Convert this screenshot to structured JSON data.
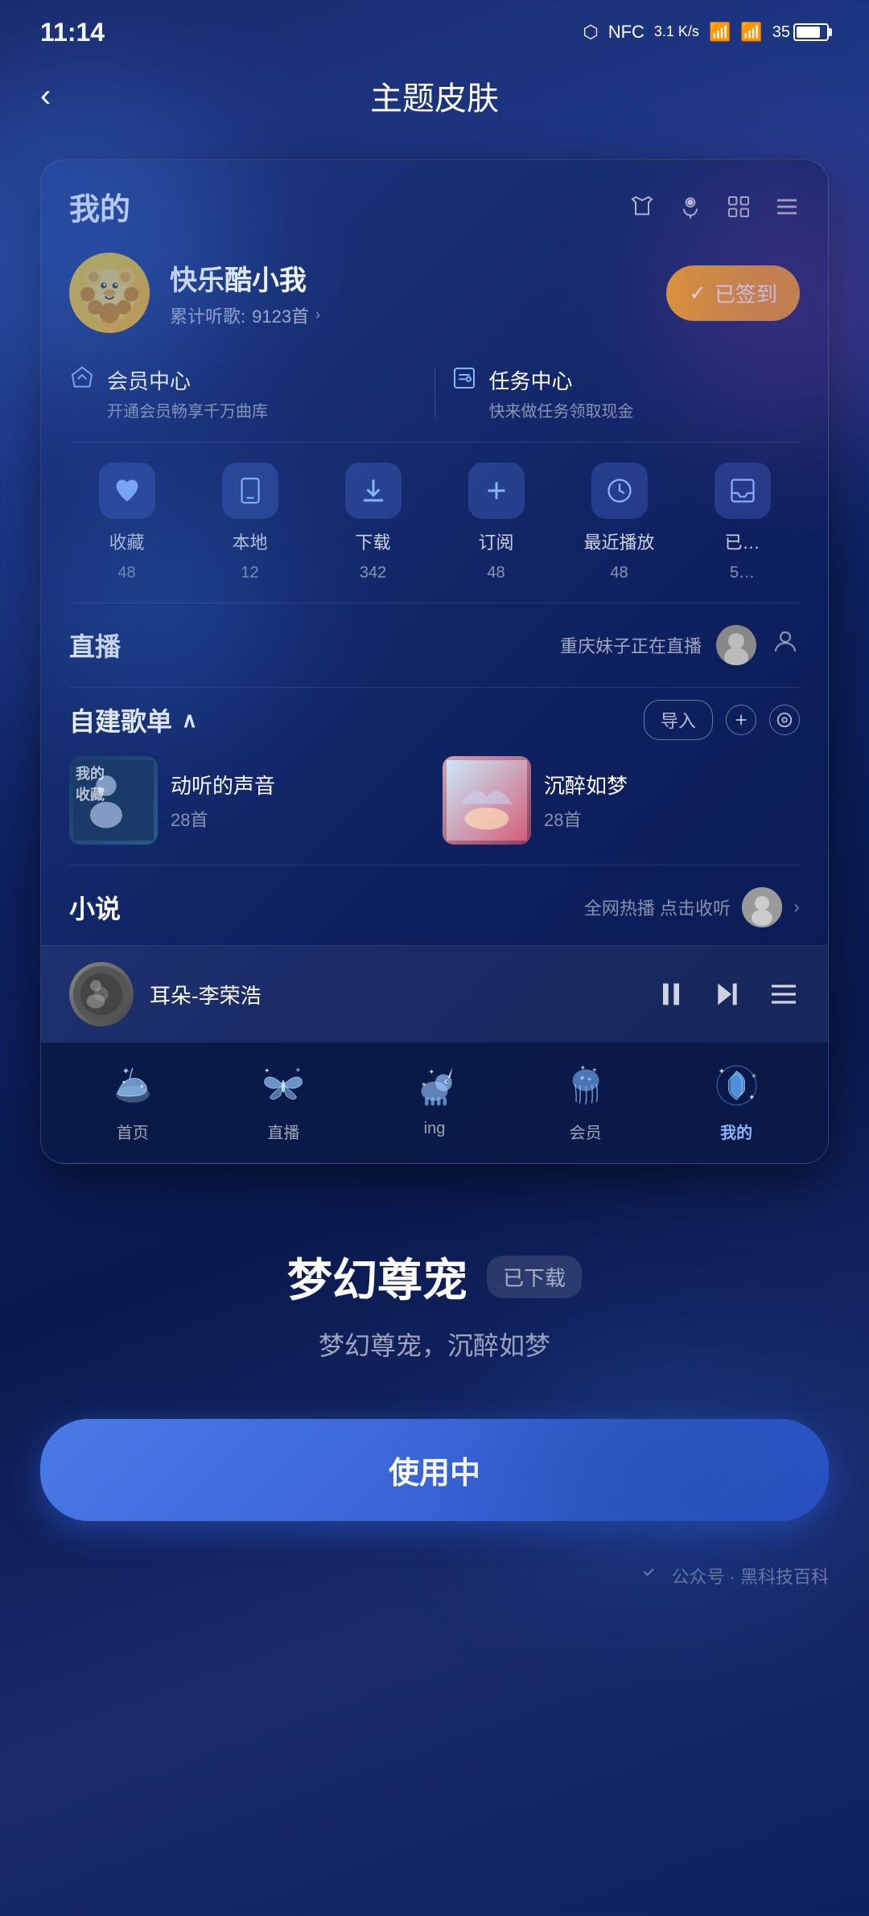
{
  "statusBar": {
    "time": "11:14",
    "network": "3.1\nK/s",
    "signal": "56",
    "battery": "35"
  },
  "header": {
    "back": "‹",
    "title": "主题皮肤"
  },
  "appPreview": {
    "topbar": {
      "title": "我的",
      "icons": [
        "shirt",
        "mic",
        "scan",
        "menu"
      ]
    },
    "user": {
      "name": "快乐酷小我",
      "statsLabel": "累计听歌:",
      "statsValue": "9123首",
      "signinBtn": "已签到"
    },
    "memberSection": {
      "item1": {
        "title": "会员中心",
        "sub": "开通会员畅享千万曲库"
      },
      "item2": {
        "title": "任务中心",
        "sub": "快来做任务领取现金"
      }
    },
    "quickActions": [
      {
        "label": "收藏",
        "count": "48",
        "icon": "♥"
      },
      {
        "label": "本地",
        "count": "12",
        "icon": "📱"
      },
      {
        "label": "下载",
        "count": "342",
        "icon": "⬇"
      },
      {
        "label": "订阅",
        "count": "48",
        "icon": "+"
      },
      {
        "label": "最近播放",
        "count": "48",
        "icon": "🕐"
      },
      {
        "label": "已…",
        "count": "5…",
        "icon": "📥"
      }
    ],
    "liveSection": {
      "title": "直播",
      "liveLabel": "重庆妹子正在直播"
    },
    "playlistSection": {
      "title": "自建歌单",
      "importBtn": "导入",
      "playlists": [
        {
          "name": "动听的声音",
          "count": "28首"
        },
        {
          "name": "沉醉如梦",
          "count": "28首"
        }
      ]
    },
    "novelSection": {
      "title": "小说",
      "label": "全网热播 点击收听"
    },
    "nowPlaying": {
      "song": "耳朵-李荣浩"
    },
    "bottomNav": [
      {
        "label": "首页",
        "active": false
      },
      {
        "label": "直播",
        "active": false
      },
      {
        "label": "ing",
        "active": false
      },
      {
        "label": "会员",
        "active": false
      },
      {
        "label": "我的",
        "active": true
      }
    ]
  },
  "themeInfo": {
    "name": "梦幻尊宠",
    "badge": "已下载",
    "desc": "梦幻尊宠，沉醉如梦"
  },
  "useButton": {
    "label": "使用中"
  },
  "watermark": {
    "platform": "微信",
    "text": "公众号 · 黑科技百科"
  }
}
